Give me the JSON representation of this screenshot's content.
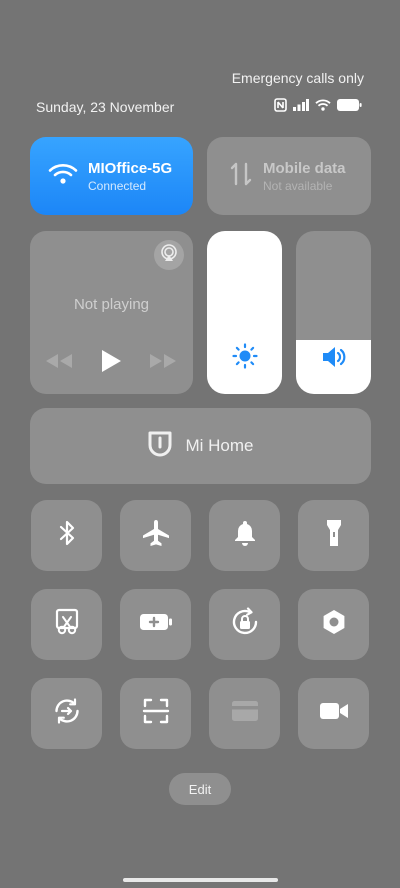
{
  "status_bar": {
    "carrier_text": "Emergency calls only",
    "date": "Sunday, 23 November",
    "icons": [
      "nfc-icon",
      "signal-icon",
      "wifi-icon",
      "battery-icon"
    ]
  },
  "wifi_tile": {
    "title": "MIOffice-5G",
    "subtitle": "Connected",
    "icon": "wifi-icon",
    "active": true,
    "accent": "#2791fa"
  },
  "mobile_data_tile": {
    "title": "Mobile data",
    "subtitle": "Not available",
    "icon": "mobile-data-icon",
    "active": false
  },
  "media": {
    "status": "Not playing",
    "controls": [
      "previous-icon",
      "play-icon",
      "next-icon"
    ],
    "cast_icon": "cast-icon"
  },
  "brightness": {
    "icon": "brightness-icon",
    "level": 1.0
  },
  "volume": {
    "icon": "volume-icon",
    "level": 0.33,
    "accent": "#1f8bf7"
  },
  "mi_home": {
    "label": "Mi Home",
    "icon": "mi-home-icon"
  },
  "toggles": [
    [
      "bluetooth-icon",
      "airplane-icon",
      "bell-icon",
      "flashlight-icon"
    ],
    [
      "screenshot-icon",
      "battery-saver-icon",
      "rotation-lock-icon",
      "settings-icon"
    ],
    [
      "sync-icon",
      "scanner-icon",
      "card-icon",
      "video-icon"
    ]
  ],
  "edit_label": "Edit"
}
